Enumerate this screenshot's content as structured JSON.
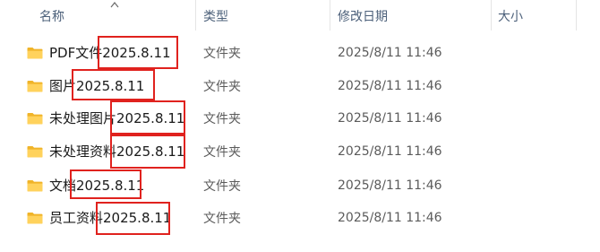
{
  "header": {
    "name": "名称",
    "type": "类型",
    "modified": "修改日期",
    "size": "大小"
  },
  "rows": [
    {
      "name": "PDF文件2025.8.11",
      "type": "文件夹",
      "modified": "2025/8/11 11:46"
    },
    {
      "name": "图片2025.8.11",
      "type": "文件夹",
      "modified": "2025/8/11 11:46"
    },
    {
      "name": "未处理图片2025.8.11",
      "type": "文件夹",
      "modified": "2025/8/11 11:46"
    },
    {
      "name": "未处理资料2025.8.11",
      "type": "文件夹",
      "modified": "2025/8/11 11:46"
    },
    {
      "name": "文档2025.8.11",
      "type": "文件夹",
      "modified": "2025/8/11 11:46"
    },
    {
      "name": "员工资料2025.8.11",
      "type": "文件夹",
      "modified": "2025/8/11 11:46"
    }
  ],
  "colors": {
    "annotation": "#e0221e",
    "folder": "#ffc83d",
    "header_text": "#4c607a"
  },
  "icons": {
    "folder": "folder-icon",
    "sort": "sort-ascending-icon"
  }
}
